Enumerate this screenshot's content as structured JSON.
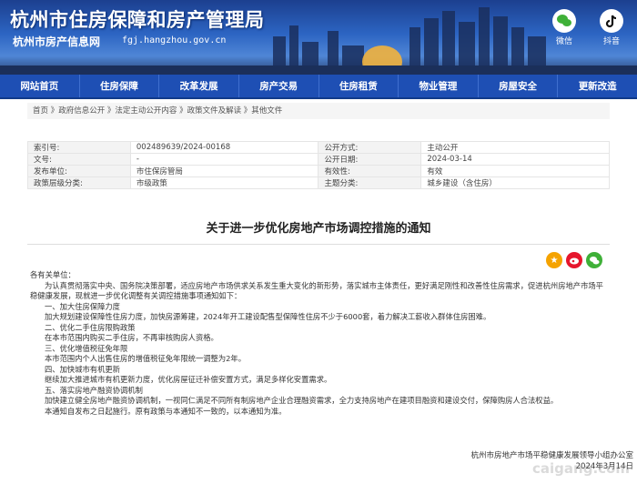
{
  "header": {
    "site_title": "杭州市住房保障和房产管理局",
    "sub_title": "杭州市房产信息网",
    "domain": "fgj.hangzhou.gov.cn",
    "wechat_label": "微信",
    "douyin_label": "抖音"
  },
  "nav": [
    "网站首页",
    "住房保障",
    "改革发展",
    "房产交易",
    "住房租赁",
    "物业管理",
    "房屋安全",
    "更新改造"
  ],
  "breadcrumb": "首页 》政府信息公开 》法定主动公开内容 》政策文件及解读 》其他文件",
  "info": [
    [
      "索引号:",
      "002489639/2024-00168",
      "公开方式:",
      "主动公开"
    ],
    [
      "文号:",
      "-",
      "公开日期:",
      "2024-03-14"
    ],
    [
      "发布单位:",
      "市住保房管局",
      "有效性:",
      "有效"
    ],
    [
      "政策层级分类:",
      "市级政策",
      "主题分类:",
      "城乡建设（含住房）"
    ]
  ],
  "doc_title": "关于进一步优化房地产市场调控措施的通知",
  "body": {
    "salutation": "各有关单位：",
    "intro": "为认真贯彻落实中央、国务院决策部署，适应房地产市场供求关系发生重大变化的新形势，落实城市主体责任，更好满足刚性和改善性住房需求，促进杭州房地产市场平稳健康发展，现就进一步优化调整有关调控措施事项通知如下：",
    "s1_title": "一、加大住房保障力度",
    "s1_text": "加大规划建设保障性住房力度，加快房源筹建，2024年开工建设配售型保障性住房不少于6000套，着力解决工薪收入群体住房困难。",
    "s2_title": "二、优化二手住房限购政策",
    "s2_text": "在本市范围内购买二手住房，不再审核购房人资格。",
    "s3_title": "三、优化增值税征免年限",
    "s3_text": "本市范围内个人出售住房的增值税征免年限统一调整为2年。",
    "s4_title": "四、加快城市有机更新",
    "s4_text": "继续加大推进城市有机更新力度，优化房屋征迁补偿安置方式，满足多样化安置需求。",
    "s5_title": "五、落实房地产融资协调机制",
    "s5_text": "加快建立健全房地产融资协调机制，一视同仁满足不同所有制房地产企业合理融资需求，全力支持房地产在建项目融资和建设交付，保障购房人合法权益。",
    "closing": "本通知自发布之日起施行。原有政策与本通知不一致的，以本通知为准。",
    "signature": "杭州市房地产市场平稳健康发展领导小组办公室",
    "date": "2024年3月14日"
  },
  "colors": {
    "nav_bg": "#1e4fb4",
    "banner_top": "#1c3f8f",
    "share_star": "#f5a300",
    "share_weibo": "#e6162d",
    "share_wechat": "#3fb038"
  },
  "watermark": "caigang.com"
}
